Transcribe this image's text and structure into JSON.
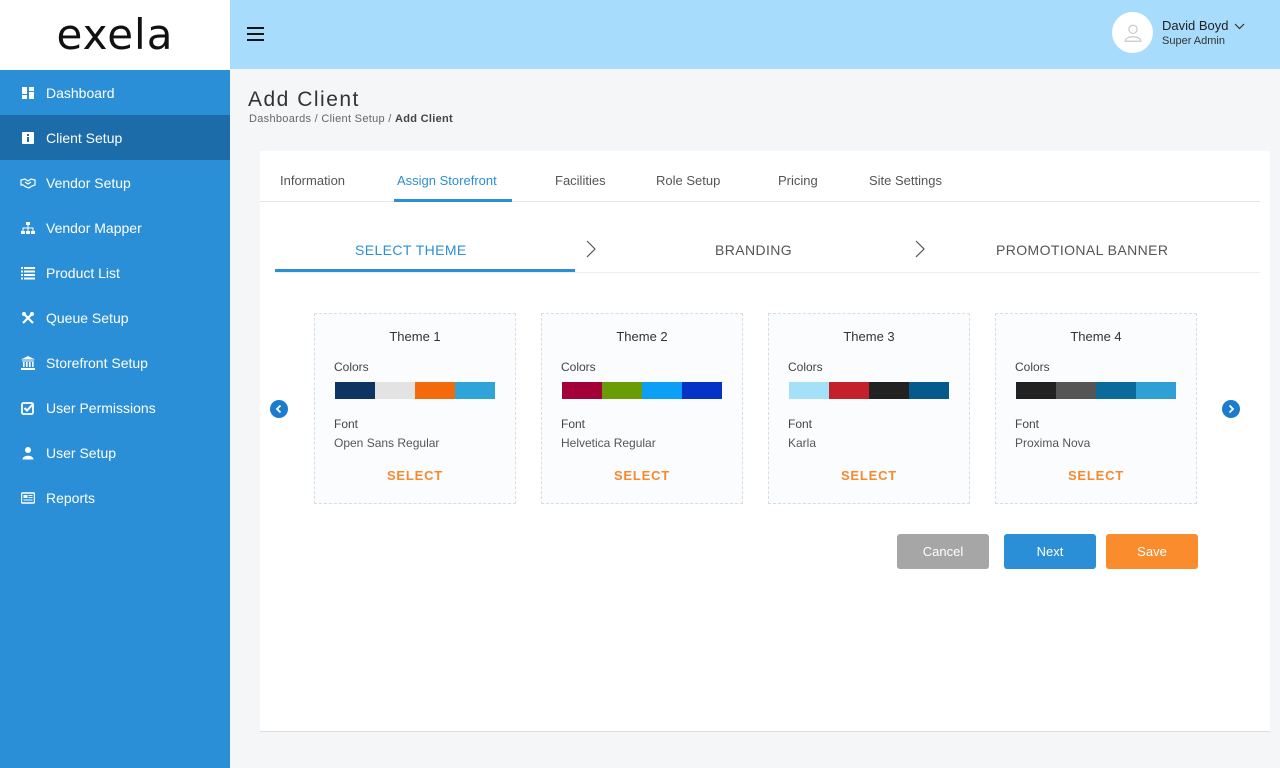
{
  "brand": {
    "logo_text": "exela"
  },
  "sidebar": {
    "items": [
      {
        "label": "Dashboard",
        "icon": "dashboard-icon"
      },
      {
        "label": "Client Setup",
        "icon": "info-icon"
      },
      {
        "label": "Vendor Setup",
        "icon": "handshake-icon"
      },
      {
        "label": "Vendor Mapper",
        "icon": "sitemap-icon"
      },
      {
        "label": "Product List",
        "icon": "list-icon"
      },
      {
        "label": "Queue Setup",
        "icon": "tools-icon"
      },
      {
        "label": "Storefront Setup",
        "icon": "bank-icon"
      },
      {
        "label": "User Permissions",
        "icon": "check-square-icon"
      },
      {
        "label": "User Setup",
        "icon": "user-icon"
      },
      {
        "label": "Reports",
        "icon": "newspaper-icon"
      }
    ],
    "active_index": 1
  },
  "header": {
    "user_name": "David Boyd",
    "user_role": "Super Admin"
  },
  "page": {
    "title": "Add Client",
    "breadcrumb": {
      "part1": "Dashboards",
      "sep": " / ",
      "part2": "Client Setup",
      "current": "Add Client"
    }
  },
  "tabs": [
    {
      "label": "Information"
    },
    {
      "label": "Assign Storefront"
    },
    {
      "label": "Facilities"
    },
    {
      "label": "Role Setup"
    },
    {
      "label": "Pricing"
    },
    {
      "label": "Site Settings"
    }
  ],
  "steps": [
    {
      "label": "SELECT THEME"
    },
    {
      "label": "BRANDING"
    },
    {
      "label": "PROMOTIONAL BANNER"
    }
  ],
  "labels": {
    "colors": "Colors",
    "font": "Font",
    "select": "SELECT"
  },
  "themes": [
    {
      "name": "Theme 1",
      "font": "Open Sans Regular",
      "colors": [
        "#0e3461",
        "#e3e3e3",
        "#f36a0c",
        "#2ea4d8"
      ]
    },
    {
      "name": "Theme 2",
      "font": "Helvetica Regular",
      "colors": [
        "#a3003a",
        "#6a9c07",
        "#0d9ef5",
        "#0433c6"
      ]
    },
    {
      "name": "Theme 3",
      "font": "Karla",
      "colors": [
        "#a4e0f8",
        "#c3202c",
        "#222222",
        "#05598c"
      ]
    },
    {
      "name": "Theme 4",
      "font": "Proxima Nova",
      "colors": [
        "#222222",
        "#555555",
        "#0a6a9b",
        "#2ea0d4"
      ]
    }
  ],
  "buttons": {
    "cancel": "Cancel",
    "next": "Next",
    "save": "Save"
  },
  "colors": {
    "sidebar": "#2a8fd6",
    "sidebar_active": "#1b6ca8",
    "header": "#a7dcfc",
    "accent": "#2a8fd6",
    "orange": "#fb8c2e"
  }
}
